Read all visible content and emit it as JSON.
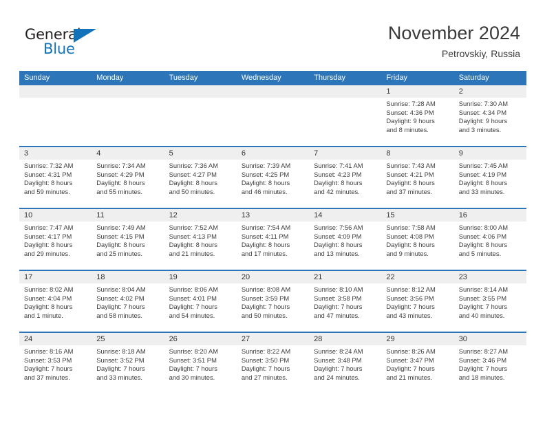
{
  "logo": {
    "word1": "General",
    "word2": "Blue",
    "triangle_color": "#1273ba",
    "text_color": "#231f20"
  },
  "header": {
    "title": "November 2024",
    "subtitle": "Petrovskiy, Russia"
  },
  "theme": {
    "header_blue": "#2c75b9",
    "daynum_strip": "#efefef",
    "text": "#3c3c3c"
  },
  "weekday_headers": [
    "Sunday",
    "Monday",
    "Tuesday",
    "Wednesday",
    "Thursday",
    "Friday",
    "Saturday"
  ],
  "weeks": [
    [
      {
        "day": "",
        "sunrise": "",
        "sunset": "",
        "daylight1": "",
        "daylight2": ""
      },
      {
        "day": "",
        "sunrise": "",
        "sunset": "",
        "daylight1": "",
        "daylight2": ""
      },
      {
        "day": "",
        "sunrise": "",
        "sunset": "",
        "daylight1": "",
        "daylight2": ""
      },
      {
        "day": "",
        "sunrise": "",
        "sunset": "",
        "daylight1": "",
        "daylight2": ""
      },
      {
        "day": "",
        "sunrise": "",
        "sunset": "",
        "daylight1": "",
        "daylight2": ""
      },
      {
        "day": "1",
        "sunrise": "Sunrise: 7:28 AM",
        "sunset": "Sunset: 4:36 PM",
        "daylight1": "Daylight: 9 hours",
        "daylight2": "and 8 minutes."
      },
      {
        "day": "2",
        "sunrise": "Sunrise: 7:30 AM",
        "sunset": "Sunset: 4:34 PM",
        "daylight1": "Daylight: 9 hours",
        "daylight2": "and 3 minutes."
      }
    ],
    [
      {
        "day": "3",
        "sunrise": "Sunrise: 7:32 AM",
        "sunset": "Sunset: 4:31 PM",
        "daylight1": "Daylight: 8 hours",
        "daylight2": "and 59 minutes."
      },
      {
        "day": "4",
        "sunrise": "Sunrise: 7:34 AM",
        "sunset": "Sunset: 4:29 PM",
        "daylight1": "Daylight: 8 hours",
        "daylight2": "and 55 minutes."
      },
      {
        "day": "5",
        "sunrise": "Sunrise: 7:36 AM",
        "sunset": "Sunset: 4:27 PM",
        "daylight1": "Daylight: 8 hours",
        "daylight2": "and 50 minutes."
      },
      {
        "day": "6",
        "sunrise": "Sunrise: 7:39 AM",
        "sunset": "Sunset: 4:25 PM",
        "daylight1": "Daylight: 8 hours",
        "daylight2": "and 46 minutes."
      },
      {
        "day": "7",
        "sunrise": "Sunrise: 7:41 AM",
        "sunset": "Sunset: 4:23 PM",
        "daylight1": "Daylight: 8 hours",
        "daylight2": "and 42 minutes."
      },
      {
        "day": "8",
        "sunrise": "Sunrise: 7:43 AM",
        "sunset": "Sunset: 4:21 PM",
        "daylight1": "Daylight: 8 hours",
        "daylight2": "and 37 minutes."
      },
      {
        "day": "9",
        "sunrise": "Sunrise: 7:45 AM",
        "sunset": "Sunset: 4:19 PM",
        "daylight1": "Daylight: 8 hours",
        "daylight2": "and 33 minutes."
      }
    ],
    [
      {
        "day": "10",
        "sunrise": "Sunrise: 7:47 AM",
        "sunset": "Sunset: 4:17 PM",
        "daylight1": "Daylight: 8 hours",
        "daylight2": "and 29 minutes."
      },
      {
        "day": "11",
        "sunrise": "Sunrise: 7:49 AM",
        "sunset": "Sunset: 4:15 PM",
        "daylight1": "Daylight: 8 hours",
        "daylight2": "and 25 minutes."
      },
      {
        "day": "12",
        "sunrise": "Sunrise: 7:52 AM",
        "sunset": "Sunset: 4:13 PM",
        "daylight1": "Daylight: 8 hours",
        "daylight2": "and 21 minutes."
      },
      {
        "day": "13",
        "sunrise": "Sunrise: 7:54 AM",
        "sunset": "Sunset: 4:11 PM",
        "daylight1": "Daylight: 8 hours",
        "daylight2": "and 17 minutes."
      },
      {
        "day": "14",
        "sunrise": "Sunrise: 7:56 AM",
        "sunset": "Sunset: 4:09 PM",
        "daylight1": "Daylight: 8 hours",
        "daylight2": "and 13 minutes."
      },
      {
        "day": "15",
        "sunrise": "Sunrise: 7:58 AM",
        "sunset": "Sunset: 4:08 PM",
        "daylight1": "Daylight: 8 hours",
        "daylight2": "and 9 minutes."
      },
      {
        "day": "16",
        "sunrise": "Sunrise: 8:00 AM",
        "sunset": "Sunset: 4:06 PM",
        "daylight1": "Daylight: 8 hours",
        "daylight2": "and 5 minutes."
      }
    ],
    [
      {
        "day": "17",
        "sunrise": "Sunrise: 8:02 AM",
        "sunset": "Sunset: 4:04 PM",
        "daylight1": "Daylight: 8 hours",
        "daylight2": "and 1 minute."
      },
      {
        "day": "18",
        "sunrise": "Sunrise: 8:04 AM",
        "sunset": "Sunset: 4:02 PM",
        "daylight1": "Daylight: 7 hours",
        "daylight2": "and 58 minutes."
      },
      {
        "day": "19",
        "sunrise": "Sunrise: 8:06 AM",
        "sunset": "Sunset: 4:01 PM",
        "daylight1": "Daylight: 7 hours",
        "daylight2": "and 54 minutes."
      },
      {
        "day": "20",
        "sunrise": "Sunrise: 8:08 AM",
        "sunset": "Sunset: 3:59 PM",
        "daylight1": "Daylight: 7 hours",
        "daylight2": "and 50 minutes."
      },
      {
        "day": "21",
        "sunrise": "Sunrise: 8:10 AM",
        "sunset": "Sunset: 3:58 PM",
        "daylight1": "Daylight: 7 hours",
        "daylight2": "and 47 minutes."
      },
      {
        "day": "22",
        "sunrise": "Sunrise: 8:12 AM",
        "sunset": "Sunset: 3:56 PM",
        "daylight1": "Daylight: 7 hours",
        "daylight2": "and 43 minutes."
      },
      {
        "day": "23",
        "sunrise": "Sunrise: 8:14 AM",
        "sunset": "Sunset: 3:55 PM",
        "daylight1": "Daylight: 7 hours",
        "daylight2": "and 40 minutes."
      }
    ],
    [
      {
        "day": "24",
        "sunrise": "Sunrise: 8:16 AM",
        "sunset": "Sunset: 3:53 PM",
        "daylight1": "Daylight: 7 hours",
        "daylight2": "and 37 minutes."
      },
      {
        "day": "25",
        "sunrise": "Sunrise: 8:18 AM",
        "sunset": "Sunset: 3:52 PM",
        "daylight1": "Daylight: 7 hours",
        "daylight2": "and 33 minutes."
      },
      {
        "day": "26",
        "sunrise": "Sunrise: 8:20 AM",
        "sunset": "Sunset: 3:51 PM",
        "daylight1": "Daylight: 7 hours",
        "daylight2": "and 30 minutes."
      },
      {
        "day": "27",
        "sunrise": "Sunrise: 8:22 AM",
        "sunset": "Sunset: 3:50 PM",
        "daylight1": "Daylight: 7 hours",
        "daylight2": "and 27 minutes."
      },
      {
        "day": "28",
        "sunrise": "Sunrise: 8:24 AM",
        "sunset": "Sunset: 3:48 PM",
        "daylight1": "Daylight: 7 hours",
        "daylight2": "and 24 minutes."
      },
      {
        "day": "29",
        "sunrise": "Sunrise: 8:26 AM",
        "sunset": "Sunset: 3:47 PM",
        "daylight1": "Daylight: 7 hours",
        "daylight2": "and 21 minutes."
      },
      {
        "day": "30",
        "sunrise": "Sunrise: 8:27 AM",
        "sunset": "Sunset: 3:46 PM",
        "daylight1": "Daylight: 7 hours",
        "daylight2": "and 18 minutes."
      }
    ]
  ]
}
